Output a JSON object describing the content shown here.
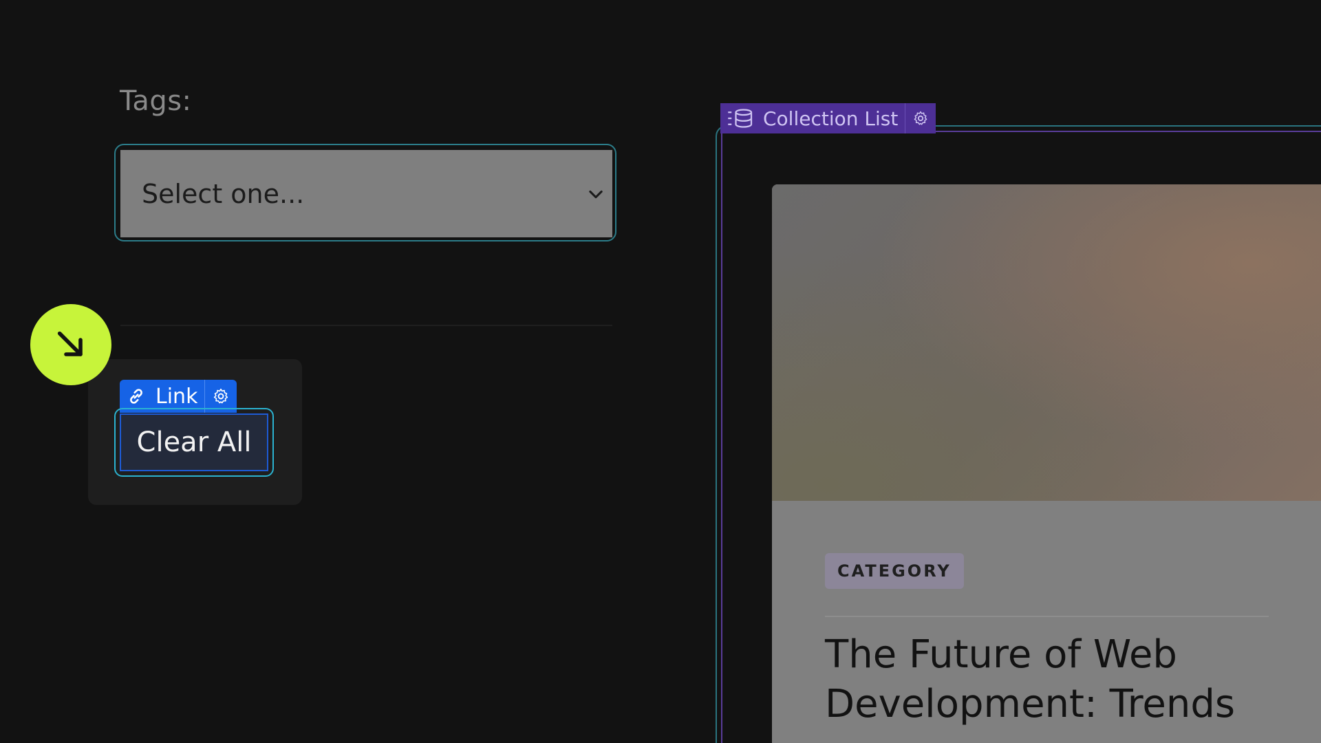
{
  "filter": {
    "tags_label": "Tags:",
    "select_value": "Select one..."
  },
  "clear": {
    "tag_label": "Link",
    "button_label": "Clear All"
  },
  "collection": {
    "tag_label": "Collection List",
    "card": {
      "category": "CATEGORY",
      "title": "The Future of Web Development: Trends"
    }
  },
  "colors": {
    "background": "#121212",
    "select_fill": "#7f7f7f",
    "link_tag": "#1663e6",
    "collection_tag": "#4d2f96",
    "cursor_badge": "#c7f43a",
    "outline_teal": "#2c7d8a"
  },
  "icons": {
    "select": "chevron-down-icon",
    "cursor": "arrow-down-right-icon",
    "link": "link-icon",
    "settings": "gear-icon",
    "collection": "database-list-icon"
  }
}
